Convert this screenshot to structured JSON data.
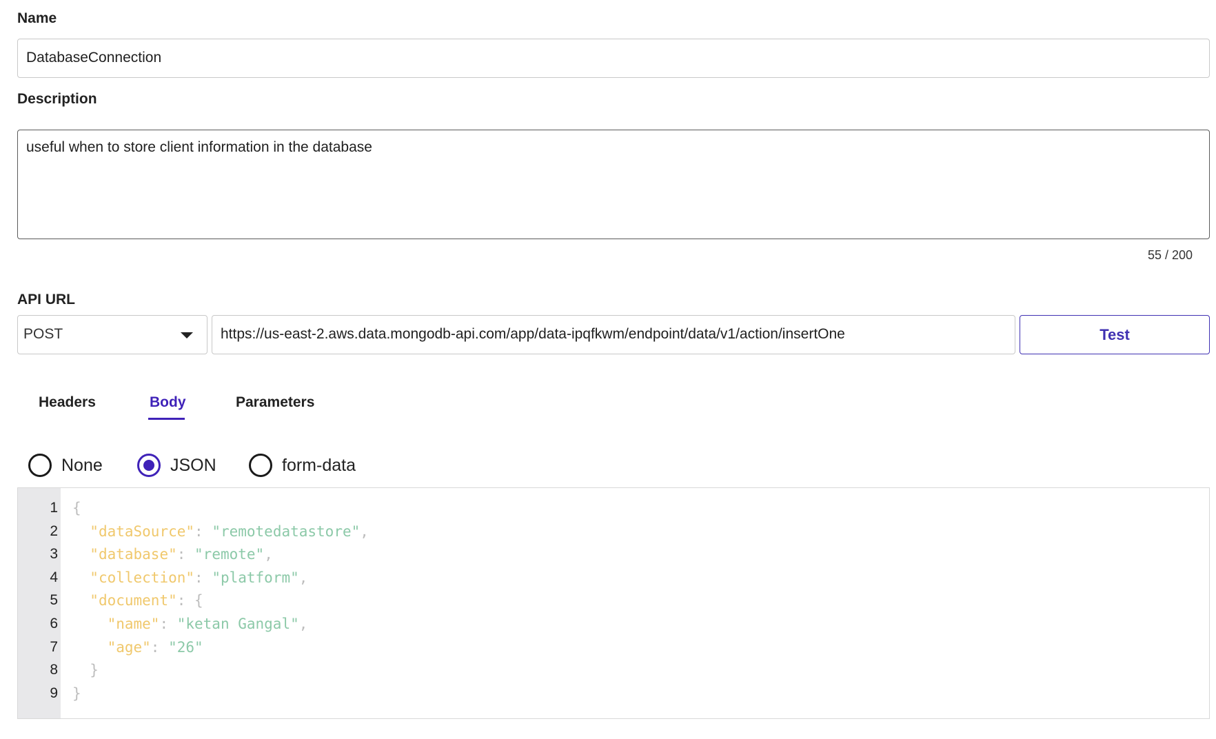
{
  "name": {
    "label": "Name",
    "value": "DatabaseConnection"
  },
  "description": {
    "label": "Description",
    "value": "useful when to store client information in the database",
    "counter": "55 / 200"
  },
  "api": {
    "label": "API URL",
    "method": "POST",
    "url": "https://us-east-2.aws.data.mongodb-api.com/app/data-ipqfkwm/endpoint/data/v1/action/insertOne",
    "test_label": "Test"
  },
  "tabs": [
    {
      "label": "Headers",
      "active": false
    },
    {
      "label": "Body",
      "active": true
    },
    {
      "label": "Parameters",
      "active": false
    }
  ],
  "body_type": {
    "options": [
      "None",
      "JSON",
      "form-data"
    ],
    "selected": "JSON"
  },
  "editor": {
    "lines": [
      {
        "no": "1",
        "indent": "",
        "key": "",
        "value": "",
        "open": "{",
        "trail": ""
      },
      {
        "no": "2",
        "indent": "  ",
        "key": "\"dataSource\"",
        "value": "\"remotedatastore\"",
        "open": "",
        "trail": ","
      },
      {
        "no": "3",
        "indent": "  ",
        "key": "\"database\"",
        "value": "\"remote\"",
        "open": "",
        "trail": ","
      },
      {
        "no": "4",
        "indent": "  ",
        "key": "\"collection\"",
        "value": "\"platform\"",
        "open": "",
        "trail": ","
      },
      {
        "no": "5",
        "indent": "  ",
        "key": "\"document\"",
        "value": "",
        "open": "{",
        "trail": ""
      },
      {
        "no": "6",
        "indent": "    ",
        "key": "\"name\"",
        "value": "\"ketan Gangal\"",
        "open": "",
        "trail": ","
      },
      {
        "no": "7",
        "indent": "    ",
        "key": "\"age\"",
        "value": "\"26\"",
        "open": "",
        "trail": ""
      },
      {
        "no": "8",
        "indent": "  ",
        "key": "",
        "value": "",
        "open": "}",
        "trail": ""
      },
      {
        "no": "9",
        "indent": "",
        "key": "",
        "value": "",
        "open": "}",
        "trail": ""
      }
    ]
  },
  "colors": {
    "accent": "#3f22b8",
    "json_key": "#f0c86c",
    "json_string": "#8cc9a8",
    "json_punct": "#bdbdbd"
  }
}
